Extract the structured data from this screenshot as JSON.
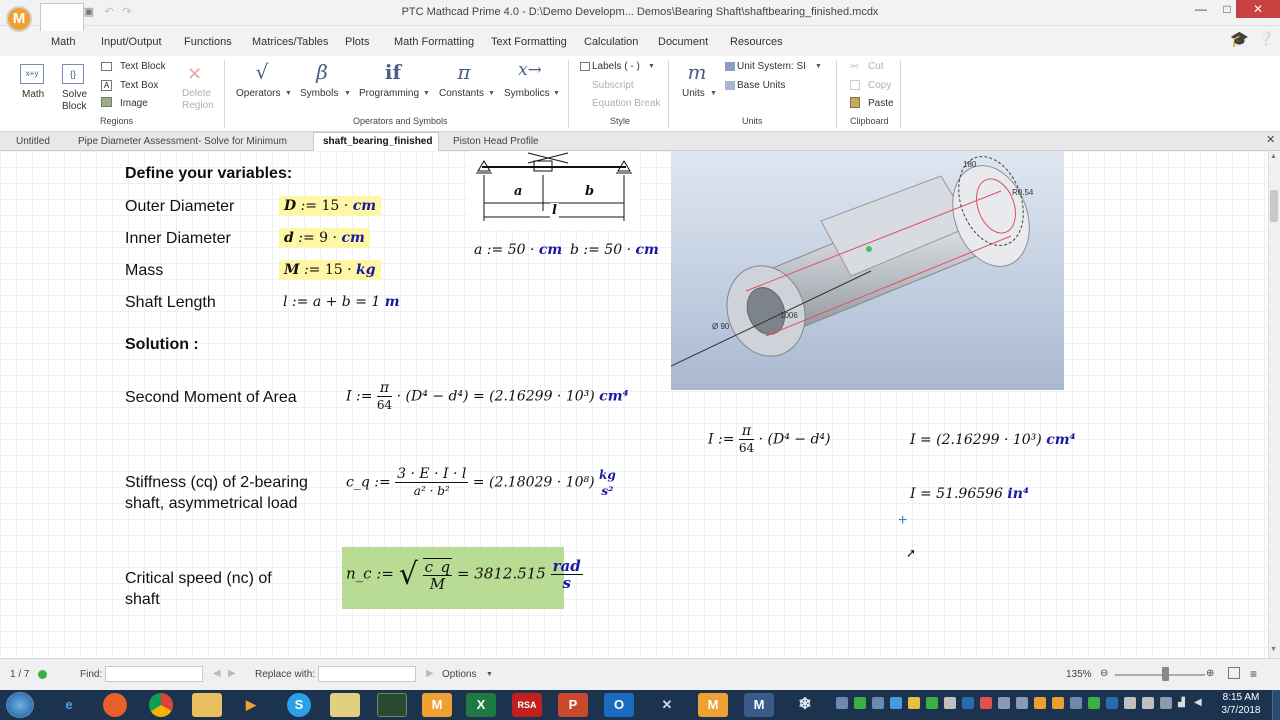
{
  "window": {
    "title": "PTC Mathcad Prime 4.0 - D:\\Demo Developm... Demos\\Bearing Shaft\\shaftbearing_finished.mcdx",
    "logo_letter": "M",
    "controls": {
      "minimize": "—",
      "maximize": "□",
      "close": "✕"
    }
  },
  "ribbon_tabs": [
    "Math",
    "Input/Output",
    "Functions",
    "Matrices/Tables",
    "Plots",
    "Math Formatting",
    "Text Formatting",
    "Calculation",
    "Document",
    "Resources"
  ],
  "ribbon": {
    "regions": {
      "math": "Math",
      "solve_block_1": "Solve",
      "solve_block_2": "Block",
      "text_block": "Text Block",
      "text_box": "Text Box",
      "image": "Image",
      "delete_region_1": "Delete",
      "delete_region_2": "Region",
      "group": "Regions"
    },
    "operators": {
      "operators": "Operators",
      "symbols": "Symbols",
      "programming": "Programming",
      "constants": "Constants",
      "symbolics": "Symbolics",
      "group": "Operators and Symbols",
      "glyphs": {
        "operators": "√",
        "symbols": "β",
        "programming": "if",
        "constants": "π",
        "symbolics": "x→"
      }
    },
    "style": {
      "labels": "Labels ( - )",
      "subscript": "Subscript",
      "equation_break": "Equation Break",
      "group": "Style"
    },
    "units": {
      "units": "Units",
      "unit_system": "Unit System:  SI",
      "base_units": "Base Units",
      "group": "Units",
      "glyph": "m"
    },
    "clipboard": {
      "cut": "Cut",
      "copy": "Copy",
      "paste": "Paste",
      "group": "Clipboard"
    }
  },
  "doc_tabs": [
    "Untitled",
    "Pipe Diameter Assessment- Solve for Minimum",
    "shaft_bearing_finished",
    "Piston Head Profile"
  ],
  "worksheet": {
    "define_heading": "Define your variables:",
    "labels": {
      "outer": "Outer Diameter",
      "inner": "Inner Diameter",
      "mass": "Mass",
      "length": "Shaft Length"
    },
    "solution_heading": "Solution :",
    "second_moment": "Second Moment of Area",
    "stiffness_1": "Stiffness (cq) of 2-bearing",
    "stiffness_2": "shaft, asymmetrical load",
    "critical_1": "Critical speed (nc) of",
    "critical_2": "shaft",
    "eq": {
      "D_var": "D",
      "D_val": "15",
      "D_unit": "cm",
      "d_var": "d",
      "d_val": "9",
      "d_unit": "cm",
      "M_var": "M",
      "M_val": "15",
      "M_unit": "kg",
      "l_expr": "l := a + b = 1",
      "l_unit": "m",
      "a_def": "a := 50",
      "a_unit": "cm",
      "b_def": "b := 50",
      "b_unit": "cm",
      "I_lhs": "I :=",
      "pi": "π",
      "sixty_four": "64",
      "I_paren": "· (D⁴ − d⁴) = (2.16299 · 10³)",
      "I_unit": "cm⁴",
      "I2_lhs": "I :=",
      "I2_paren": "· (D⁴ − d⁴)",
      "I3": "I = (2.16299 · 10³)",
      "I3_unit": "cm⁴",
      "I4": "I = 51.96596",
      "I4_unit": "in⁴",
      "cq_lhs": "c_q :=",
      "cq_num": "3 · E · I · l",
      "cq_den": "a² · b²",
      "cq_result": "= (2.18029 · 10⁸)",
      "cq_unit_num": "kg",
      "cq_unit_den": "s²",
      "nc_lhs": "n_c :=",
      "nc_num": "c_q",
      "nc_den": "M",
      "nc_result": "= 3812.515",
      "nc_unit_num": "rad",
      "nc_unit_den": "s"
    },
    "diagram_labels": {
      "a": "a",
      "b": "b",
      "l": "l"
    },
    "cad_labels": {
      "d1": "180",
      "d2": "R0.54",
      "d3": "1006",
      "d4": "Ø 90"
    }
  },
  "status": {
    "page": "1 / 7",
    "find_label": "Find:",
    "replace_label": "Replace with:",
    "options": "Options",
    "zoom": "135%"
  },
  "taskbar": {
    "clock_time": "8:15 AM",
    "clock_date": "3/7/2018",
    "apps": [
      "start",
      "ie",
      "firefox",
      "chrome",
      "explorer",
      "media",
      "skype",
      "folder",
      "terminal",
      "mathcad",
      "excel",
      "rsa",
      "powerpoint",
      "outlook",
      "tools",
      "mathcad",
      "mathcad-prime",
      "snowflake"
    ]
  },
  "colors": {
    "accent": "#1a1aa0",
    "highlight_yellow": "#fdf7a6",
    "highlight_green": "#b8dc94",
    "taskbar": "#1c3350"
  }
}
